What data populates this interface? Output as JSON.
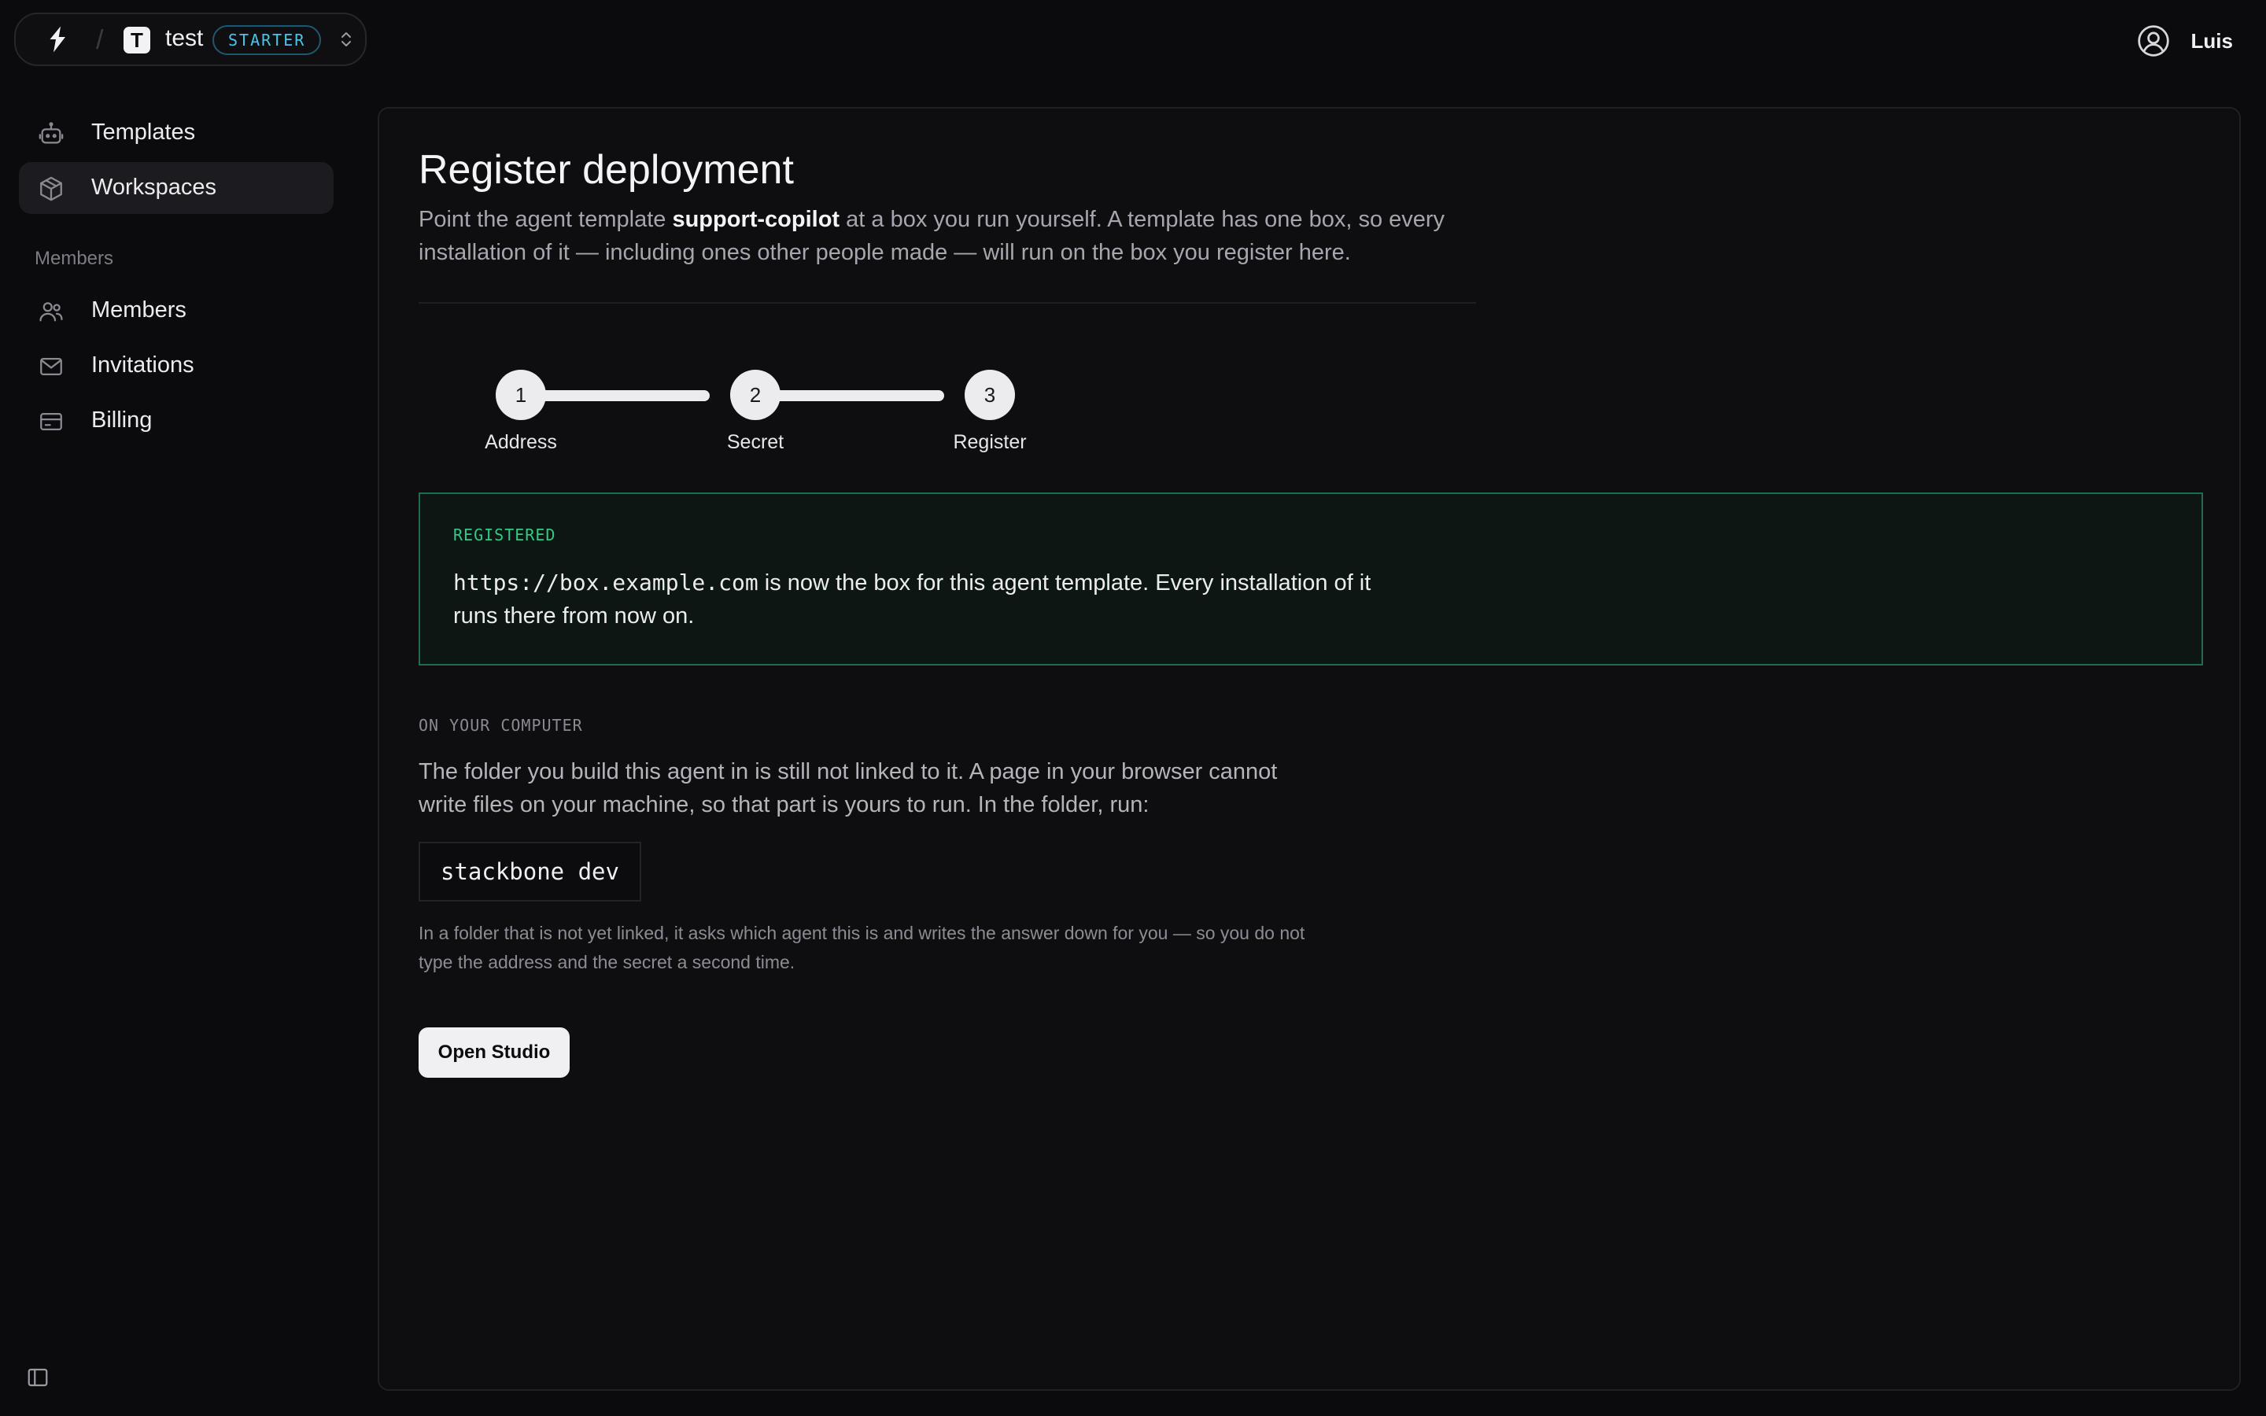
{
  "header": {
    "workspace_initial": "T",
    "workspace_name": "test",
    "plan_badge": "STARTER",
    "separator": "/",
    "user_name": "Luis"
  },
  "sidebar": {
    "items": [
      {
        "label": "Templates",
        "icon": "bot-icon"
      },
      {
        "label": "Workspaces",
        "icon": "box-icon",
        "active": true
      }
    ],
    "section_label": "Members",
    "section_items": [
      {
        "label": "Members",
        "icon": "users-icon"
      },
      {
        "label": "Invitations",
        "icon": "mail-icon"
      },
      {
        "label": "Billing",
        "icon": "card-icon"
      }
    ]
  },
  "main": {
    "title": "Register deployment",
    "intro_before": "Point the agent template ",
    "intro_template": "support-copilot",
    "intro_after": " at a box you run yourself. A template has one box, so every installation of it — including ones other people made — will run on the box you register here.",
    "steps": [
      {
        "number": "1",
        "label": "Address"
      },
      {
        "number": "2",
        "label": "Secret"
      },
      {
        "number": "3",
        "label": "Register"
      }
    ],
    "registered": {
      "tag": "REGISTERED",
      "url": "https://box.example.com",
      "text": " is now the box for this agent template. Every installation of it runs there from now on."
    },
    "computer": {
      "tag": "ON YOUR COMPUTER",
      "text": "The folder you build this agent in is still not linked to it. A page in your browser cannot write files on your machine, so that part is yours to run. In the folder, run:",
      "command": "stackbone dev",
      "hint": "In a folder that is not yet linked, it asks which agent this is and writes the answer down for you — so you do not type the address and the secret a second time."
    },
    "open_button": "Open Studio"
  },
  "colors": {
    "background": "#0b0b0d",
    "panel": "#0e0e11",
    "accent_green": "#35c987",
    "badge_blue": "#4cc3e8"
  }
}
